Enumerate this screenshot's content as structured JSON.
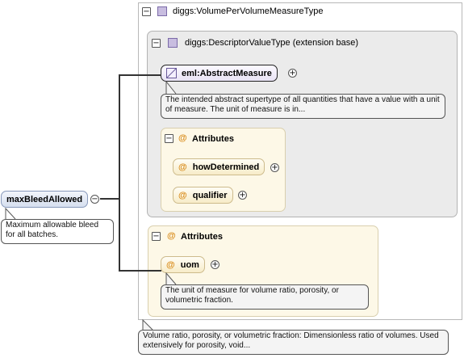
{
  "outer_type": {
    "label": "diggs:VolumePerVolumeMeasureType",
    "description": "Volume ratio, porosity, or volumetric fraction: Dimensionless ratio of volumes. Used extensively for porosity, void..."
  },
  "extension": {
    "label": "diggs:DescriptorValueType (extension base)",
    "abstract_element": "eml:AbstractMeasure",
    "abstract_description": "The intended abstract supertype of all quantities that have a value with a unit of measure. The unit of measure is in...",
    "attributes_title": "Attributes",
    "attributes": [
      {
        "name": "howDetermined"
      },
      {
        "name": "qualifier"
      }
    ]
  },
  "attributes2": {
    "title": "Attributes",
    "uom_name": "uom",
    "uom_description": "The unit of measure for volume ratio, porosity, or volumetric fraction."
  },
  "root": {
    "label": "maxBleedAllowed",
    "description": "Maximum allowable bleed for all batches."
  },
  "glyphs": {
    "minus": "−",
    "plus": "+",
    "at": "@"
  },
  "colors": {
    "attribute_at": "#d98c1c",
    "type_icon": "#c8bde0",
    "ext_bg": "#ebebeb",
    "attr_bg": "#fdf8e7"
  }
}
